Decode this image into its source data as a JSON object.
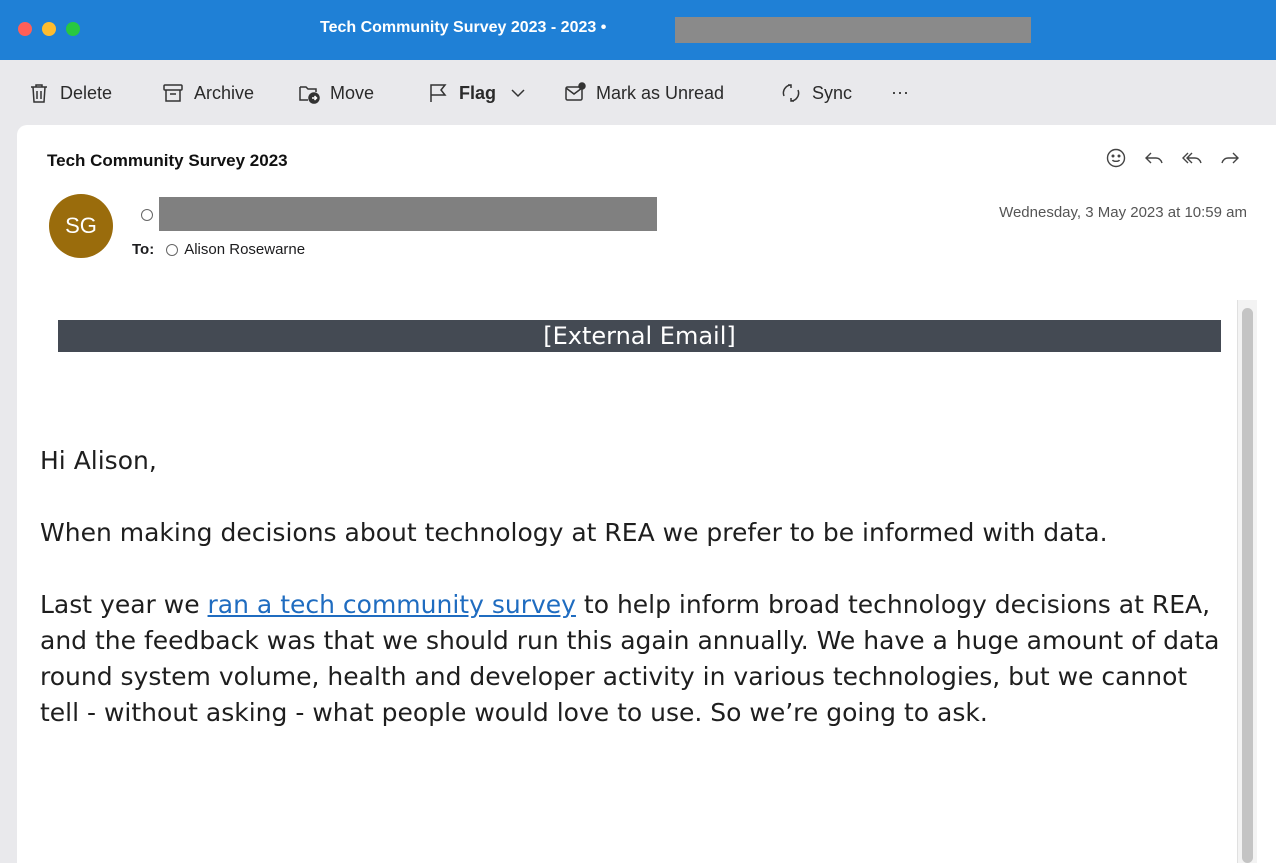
{
  "window": {
    "title": "Tech Community Survey 2023 - 2023 •"
  },
  "toolbar": {
    "delete_label": "Delete",
    "archive_label": "Archive",
    "move_label": "Move",
    "flag_label": "Flag",
    "mark_unread_label": "Mark as Unread",
    "sync_label": "Sync",
    "more_label": "···"
  },
  "message": {
    "subject": "Tech Community Survey 2023",
    "avatar_initials": "SG",
    "avatar_color": "#9a6c0c",
    "date": "Wednesday, 3 May 2023 at 10:59 am",
    "to_label": "To:",
    "to_name": "Alison Rosewarne",
    "external_banner": "[External Email]",
    "greeting": "Hi Alison,",
    "para1": "When making decisions about technology at REA we prefer to be informed with data.",
    "para2_before": "Last year we ",
    "para2_link": "ran a tech community survey",
    "para2_after": " to help inform broad technology decisions at REA, and the feedback was that we should run this again annually. We have a huge amount of data round system volume, health and developer activity in various technologies, but we cannot tell - without asking - what people would love to use. So we’re going to ask."
  },
  "colors": {
    "titlebar": "#1f80d6",
    "banner": "#444a53",
    "link": "#1f6cc0"
  }
}
